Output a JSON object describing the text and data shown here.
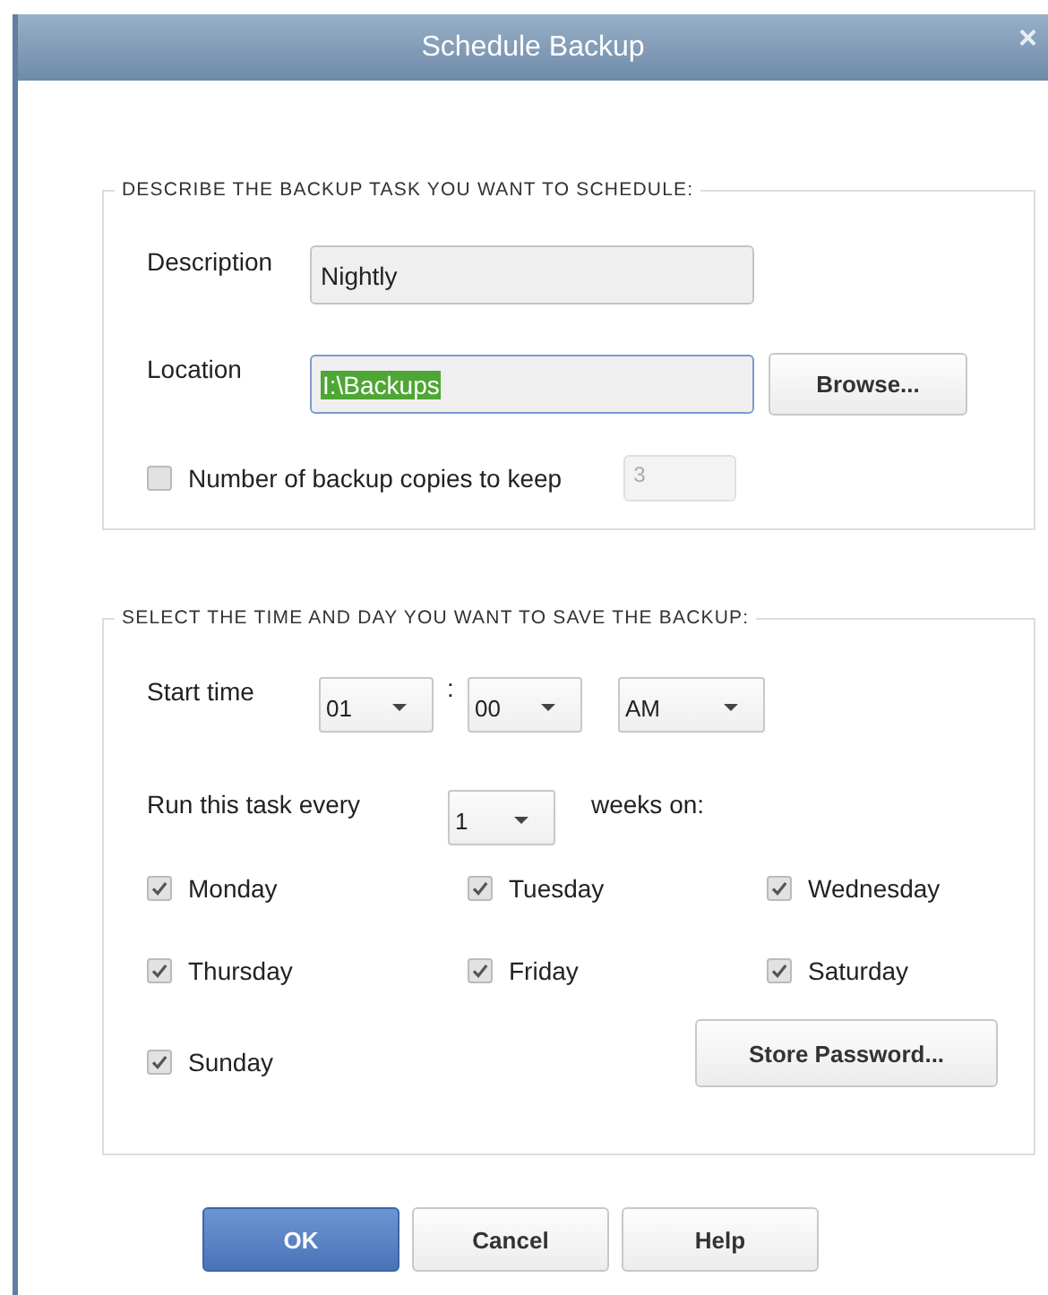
{
  "window": {
    "title": "Schedule Backup",
    "close": "×"
  },
  "task_group": {
    "legend": "DESCRIBE THE BACKUP TASK YOU WANT TO SCHEDULE:",
    "description": {
      "label": "Description",
      "value": "Nightly",
      "focused": false
    },
    "location": {
      "label": "Location",
      "value": "I:\\Backups",
      "focused": true
    },
    "browse_button": "Browse...",
    "copies": {
      "label": "Number of backup copies to keep",
      "checked": false,
      "value": "3",
      "disabled": true
    }
  },
  "time_group": {
    "legend": "SELECT THE TIME AND DAY YOU WANT TO SAVE THE BACKUP:",
    "start_label": "Start time",
    "hour": "01",
    "separator": ":",
    "minute": "00",
    "ampm": "AM",
    "run_label": "Run this task every",
    "weeks": "1",
    "weeks_label": "weeks on:",
    "days": [
      {
        "label": "Monday",
        "checked": true
      },
      {
        "label": "Tuesday",
        "checked": true
      },
      {
        "label": "Wednesday",
        "checked": true
      },
      {
        "label": "Thursday",
        "checked": true
      },
      {
        "label": "Friday",
        "checked": true
      },
      {
        "label": "Saturday",
        "checked": true
      },
      {
        "label": "Sunday",
        "checked": true
      }
    ],
    "store_password_button": "Store Password..."
  },
  "buttons": [
    {
      "label": "OK",
      "kind": "primary"
    },
    {
      "label": "Cancel",
      "kind": "normal"
    },
    {
      "label": "Help",
      "kind": "normal"
    }
  ]
}
